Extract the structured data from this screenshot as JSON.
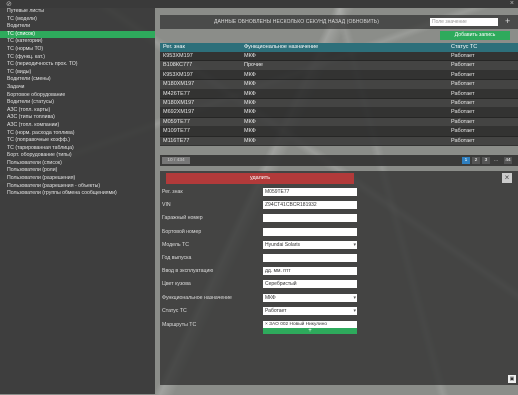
{
  "topbar": {
    "close_glyph": "×"
  },
  "sidebar": {
    "items": [
      {
        "label": "Путевые листы",
        "active": false
      },
      {
        "label": "ТС (модели)",
        "active": false
      },
      {
        "label": "Водители",
        "active": false
      },
      {
        "label": "ТС (список)",
        "active": true
      },
      {
        "label": "ТС (категории)",
        "active": false
      },
      {
        "label": "ТС (нормы ТО)",
        "active": false
      },
      {
        "label": "ТС (функц. кат.)",
        "active": false
      },
      {
        "label": "ТС (периодичность прох. ТО)",
        "active": false
      },
      {
        "label": "ТС (виды)",
        "active": false
      },
      {
        "label": "Водители (смены)",
        "active": false
      },
      {
        "label": "Задачи",
        "active": false
      },
      {
        "label": "Бортовое оборудование",
        "active": false
      },
      {
        "label": "Водители (статусы)",
        "active": false
      },
      {
        "label": "АЗС (топл. карты)",
        "active": false
      },
      {
        "label": "АЗС (типы топлива)",
        "active": false
      },
      {
        "label": "АЗС (топл. компании)",
        "active": false
      },
      {
        "label": "ТС (норм. расхода топлива)",
        "active": false
      },
      {
        "label": "ТС (поправочные коэфф.)",
        "active": false
      },
      {
        "label": "ТС (тарированная таблица)",
        "active": false
      },
      {
        "label": "Борт. оборудование (типы)",
        "active": false
      },
      {
        "label": "Пользователи (список)",
        "active": false
      },
      {
        "label": "Пользователи (роли)",
        "active": false
      },
      {
        "label": "Пользователи (разрешения)",
        "active": false
      },
      {
        "label": "Пользователи (разрешения - объекты)",
        "active": false
      },
      {
        "label": "Пользователи (группы обмена сообщениями)",
        "active": false
      }
    ]
  },
  "header": {
    "status_message": "ДАННЫЕ ОБНОВЛЕНЫ НЕСКОЛЬКО СЕКУНД НАЗАД (ОБНОВИТЬ)",
    "search_placeholder": "Поле значение",
    "add_icon": "+",
    "add_record_label": "Добавить запись"
  },
  "table": {
    "columns": [
      "Рег. знак",
      "Функциональное назначение",
      "Статус ТС"
    ],
    "rows": [
      [
        "К953ХМ197",
        "МКФ",
        "Работает"
      ],
      [
        "В108КС777",
        "Прочие",
        "Работает"
      ],
      [
        "К953ХМ197",
        "МКФ",
        "Работает"
      ],
      [
        "М180ХМ197",
        "МКФ",
        "Работает"
      ],
      [
        "М426ТЕ77",
        "МКФ",
        "Работает"
      ],
      [
        "М180ХМ197",
        "МКФ",
        "Работает"
      ],
      [
        "М692ХМ197",
        "МКФ",
        "Работает"
      ],
      [
        "М059ТЕ77",
        "МКФ",
        "Работает"
      ],
      [
        "М109ТЕ77",
        "МКФ",
        "Работает"
      ],
      [
        "М116ТЕ77",
        "МКФ",
        "Работает"
      ]
    ]
  },
  "pager": {
    "count": "10 / 434",
    "pages": [
      "1",
      "2",
      "3",
      "...",
      "44"
    ],
    "current_page": "1"
  },
  "detail": {
    "delete_label": "удалить",
    "close_glyph": "×",
    "fields": [
      {
        "label": "Рег. знак",
        "value": "М059ТЕ77",
        "type": "text"
      },
      {
        "label": "VIN",
        "value": "Z94CT41CBCR181932",
        "type": "text"
      },
      {
        "label": "Гаражный номер",
        "value": "",
        "type": "text"
      },
      {
        "label": "Бортовой номер",
        "value": "",
        "type": "text"
      },
      {
        "label": "Модель ТС",
        "value": "Hyundai Solaris",
        "type": "select"
      },
      {
        "label": "Год выпуска",
        "value": "",
        "type": "text"
      },
      {
        "label": "Ввод в эксплуатацию",
        "value": "дд. мм. гггг",
        "type": "text"
      },
      {
        "label": "Цвет кузова",
        "value": "Серебристый",
        "type": "text"
      },
      {
        "label": "Функциональное назначение",
        "value": "МКФ",
        "type": "select"
      },
      {
        "label": "Статус ТС",
        "value": "Работает",
        "type": "select"
      }
    ],
    "routes_label": "Маршруты ТС",
    "route_value": "× ЗАО 002 Новый Никулино",
    "route_add": "+"
  },
  "colors": {
    "accent_green": "#2eaa5c",
    "header_teal": "#2d6f7a",
    "danger_red": "#b23a3a",
    "page_blue": "#2e7fc0"
  },
  "icons": [
    "logo-icon",
    "close-icon",
    "add-icon",
    "chevron-down-icon",
    "route-remove-icon",
    "corner-icon"
  ]
}
